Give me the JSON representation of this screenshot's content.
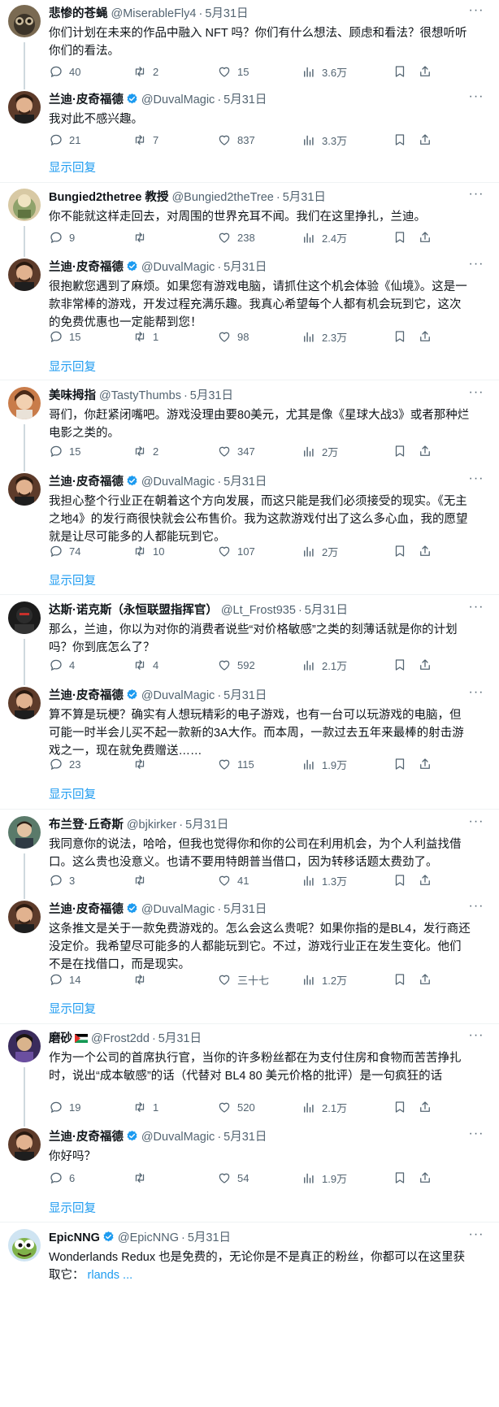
{
  "colors": {
    "link": "#1d9bf0",
    "muted": "#536471",
    "verified": "#1d9bf0",
    "divider": "#eff3f4"
  },
  "icons": {
    "reply": "reply-icon",
    "retweet": "retweet-icon",
    "like": "heart-icon",
    "views": "views-icon",
    "bookmark": "bookmark-icon",
    "share": "share-icon",
    "more": "more-icon",
    "verified": "verified-badge-icon"
  },
  "show_replies_label": "显示回复",
  "tweets": [
    {
      "name": "悲惨的苍蝇",
      "handle": "@MiserableFly4",
      "time": "5月31日",
      "verified": false,
      "text": "你们计划在未来的作品中融入 NFT 吗？你们有什么想法、顾虑和看法？很想听听你们的看法。",
      "replies": "40",
      "retweets": "2",
      "likes": "15",
      "views": "3.6万"
    },
    {
      "name": "兰迪·皮奇福德",
      "handle": "@DuvalMagic",
      "time": "5月31日",
      "verified": true,
      "text": "我对此不感兴趣。",
      "replies": "21",
      "retweets": "7",
      "likes": "837",
      "views": "3.3万"
    },
    {
      "name": "Bungied2thetree 教授",
      "handle": "@Bungied2theTree",
      "time": "5月31日",
      "verified": false,
      "text": "你不能就这样走回去，对周围的世界充耳不闻。我们在这里挣扎，兰迪。",
      "replies": "9",
      "retweets": "",
      "likes": "238",
      "views": "2.4万"
    },
    {
      "name": "兰迪·皮奇福德",
      "handle": "@DuvalMagic",
      "time": "5月31日",
      "verified": true,
      "text": "很抱歉您遇到了麻烦。如果您有游戏电脑，请抓住这个机会体验《仙境》。这是一款非常棒的游戏，开发过程充满乐趣。我真心希望每个人都有机会玩到它，这次的免费优惠也一定能帮到您！",
      "replies": "15",
      "retweets": "1",
      "likes": "98",
      "views": "2.3万"
    },
    {
      "name": "美味拇指",
      "handle": "@TastyThumbs",
      "time": "5月31日",
      "verified": false,
      "text": "哥们，你赶紧闭嘴吧。游戏没理由要80美元，尤其是像《星球大战3》或者那种烂电影之类的。",
      "replies": "15",
      "retweets": "2",
      "likes": "347",
      "views": "2万"
    },
    {
      "name": "兰迪·皮奇福德",
      "handle": "@DuvalMagic",
      "time": "5月31日",
      "verified": true,
      "text": "我担心整个行业正在朝着这个方向发展，而这只能是我们必须接受的现实。《无主之地4》的发行商很快就会公布售价。我为这款游戏付出了这么多心血，我的愿望就是让尽可能多的人都能玩到它。",
      "replies": "74",
      "retweets": "10",
      "likes": "107",
      "views": "2万"
    },
    {
      "name": "达斯·诺克斯（永恒联盟指挥官）",
      "handle": "@Lt_Frost935",
      "time": "5月31日",
      "verified": false,
      "text": "那么，兰迪，你以为对你的消费者说些“对价格敏感”之类的刻薄话就是你的计划吗？你到底怎么了？",
      "replies": "4",
      "retweets": "4",
      "likes": "592",
      "views": "2.1万"
    },
    {
      "name": "兰迪·皮奇福德",
      "handle": "@DuvalMagic",
      "time": "5月31日",
      "verified": true,
      "text": "算不算是玩梗？确实有人想玩精彩的电子游戏，也有一台可以玩游戏的电脑，但可能一时半会儿买不起一款新的3A大作。而本周，一款过去五年来最棒的射击游戏之一，现在就免费赠送……",
      "replies": "23",
      "retweets": "",
      "likes": "115",
      "views": "1.9万"
    },
    {
      "name": "布兰登·丘奇斯",
      "handle": "@bjkirker",
      "time": "5月31日",
      "verified": false,
      "text": "我同意你的说法，哈哈，但我也觉得你和你的公司在利用机会，为个人利益找借口。这么贵也没意义。也请不要用特朗普当借口，因为转移话题太费劲了。",
      "replies": "3",
      "retweets": "",
      "likes": "41",
      "views": "1.3万"
    },
    {
      "name": "兰迪·皮奇福德",
      "handle": "@DuvalMagic",
      "time": "5月31日",
      "verified": true,
      "text": "这条推文是关于一款免费游戏的。怎么会这么贵呢？如果你指的是BL4，发行商还没定价。我希望尽可能多的人都能玩到它。不过，游戏行业正在发生变化。他们不是在找借口，而是现实。",
      "replies": "14",
      "retweets": "",
      "likes": "三十七",
      "views": "1.2万"
    },
    {
      "name": "磨砂",
      "handle": "@Frost2dd",
      "time": "5月31日",
      "verified": false,
      "flag": true,
      "text": "作为一个公司的首席执行官，当你的许多粉丝都在为支付住房和食物而苦苦挣扎时，说出“成本敏感”的话（代替对 BL4 80 美元价格的批评）是一句疯狂的话",
      "replies": "19",
      "retweets": "1",
      "likes": "520",
      "views": "2.1万"
    },
    {
      "name": "兰迪·皮奇福德",
      "handle": "@DuvalMagic",
      "time": "5月31日",
      "verified": true,
      "text": "你好吗？",
      "replies": "6",
      "retweets": "",
      "likes": "54",
      "views": "1.9万"
    },
    {
      "name": "EpicNNG",
      "handle": "@EpicNNG",
      "time": "5月31日",
      "verified": true,
      "text": "Wonderlands Redux 也是免费的，无论你是不是真正的粉丝，你都可以在这里获取它：",
      "link": "rlands ...",
      "replies": "",
      "retweets": "",
      "likes": "",
      "views": ""
    }
  ]
}
